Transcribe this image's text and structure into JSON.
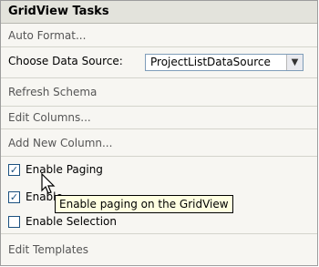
{
  "panel": {
    "title": "GridView Tasks",
    "auto_format": "Auto Format...",
    "data_source_label": "Choose Data Source:",
    "data_source_value": "ProjectListDataSource",
    "refresh_schema": "Refresh Schema",
    "edit_columns": "Edit Columns...",
    "add_column": "Add New Column...",
    "enable_paging": {
      "label": "Enable Paging",
      "checked": true
    },
    "enable_sorting": {
      "label": "Enable",
      "checked": true
    },
    "enable_selection": {
      "label": "Enable Selection",
      "checked": false
    },
    "edit_templates": "Edit Templates"
  },
  "tooltip": "Enable paging on the GridView",
  "icons": {
    "checkmark": "✓",
    "dropdown": "▼"
  }
}
